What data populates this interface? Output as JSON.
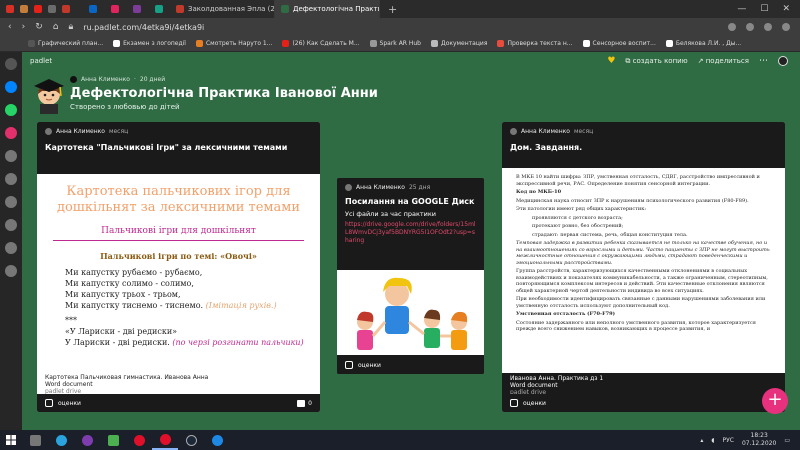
{
  "browser": {
    "tabs": [
      {
        "label": "Заколдованная Эпла (200...",
        "active": false
      },
      {
        "label": "Дефектологічна Практик...",
        "active": true
      }
    ],
    "url": "ru.padlet.com/4etka9i/4etka9i",
    "bookmarks": [
      "Графический план...",
      "Екзамен з логопедії",
      "Смотреть Наруто 1...",
      "(26) Как Сделать М...",
      "Spark AR Hub",
      "Документация",
      "Проверка текста н...",
      "Сенсорное воспит...",
      "Белякова Л.И. , Ды..."
    ]
  },
  "padlet": {
    "brand": "padlet",
    "actions": {
      "remix": "создать копию",
      "share": "поделиться"
    },
    "author": "Анна Клименко",
    "posted": "20 дней",
    "title": "Дефектологічна Практика Іванової Анни",
    "subtitle": "Створено з любовью до дітей"
  },
  "cards": [
    {
      "author": "Анна Клименко",
      "time": "месяц",
      "title": "Картотека \"Пальчикові Ігри\" за лексичними темами",
      "doc": {
        "heading": "Картотека пальчикових ігор для дошкільнят за лексичними темами",
        "pink": "Пальчикові ігри для дошкільнят",
        "topic": "Пальчикові ігри по темі: «Овочі»",
        "lines": [
          "Ми капустку рубаємо - рубаємо,",
          "Ми капустку солимо - солимо,",
          "Ми капустку трьох - трьом,",
          "Ми капустку тиснемо - тиснемо."
        ],
        "remark": "(Імітація рухів.)",
        "sep": "***",
        "lines2": [
          "«У Лариски - дві редиски»",
          "У Лариски - дві редиски."
        ],
        "remark2": "(по черзі розгинати пальчики)"
      },
      "attachment": {
        "name": "Картотека Пальчиковая гимнастика. Иванова Анна",
        "type": "Word document",
        "source": "padlet drive"
      },
      "footer": "оценки"
    },
    {
      "author": "Анна Клименко",
      "time": "25 дня",
      "title": "Посилання на GOOGLE Диск",
      "desc": "Усі файли за час практики",
      "link": "https://drive.google.com/drive/folders/15mlL8WmvDCj3yaf5BDNYRG5I1OFOdt2?usp=sharing",
      "footer": "оценки"
    },
    {
      "author": "Анна Клименко",
      "time": "месяц",
      "title": "Дом. Завдання.",
      "doc": {
        "p1": "В МКБ 10 найти шифры: ЗПР, умственная отсталость, СДВГ, расстройство импрессивной и экспрессивной речи, РАС. Определение понятия сенсорной интеграции.",
        "h1": "Код по МКБ-10",
        "p2": "Медицинская наука относит ЗПР к нарушениям психологического развития (F80-F89).",
        "p3": "Эти патологии имеют ряд общих характеристик:",
        "bullets": [
          "проявляются с детского возраста;",
          "протекают ровно, без обострений;",
          "страдают: первая система, речь, общая конституция тела."
        ],
        "p4": "Темповая задержка в развитии ребенка сказывается не только на качестве обучения, но и на взаимоотношениях со взрослыми и детьми. Часто пациенты с ЗПР не могут выстроить межличностные отношения с окружающими людьми, страдают поведенческими и эмоциональными расстройствами.",
        "p5": "Группа расстройств, характеризующихся качественными отклонениями в социальных взаимодействиях и показателях коммуникабельности, а также ограниченным, стереотипным, повторяющимся комплексом интересов и действий. Эти качественные отклонения являются общей характерной чертой деятельности индивида во всех ситуациях.",
        "p6": "При необходимости идентифицировать связанные с данными нарушениями заболевания или умственную отсталость используют дополнительный код.",
        "h2": "Умственная отсталость (F70-F79)",
        "p7": "Состояние задержанного или неполного умственного развития, которое характеризуется прежде всего снижением навыков, возникающих в процессе развития, и"
      },
      "attachment": {
        "name": "Иванова Анна. Практика дз 1",
        "type": "Word document",
        "source": "padlet drive"
      },
      "footer": "оценки"
    }
  ],
  "fab": "+",
  "taskbar": {
    "lang": "РУС",
    "time": "18:23",
    "date": "07.12.2020"
  }
}
